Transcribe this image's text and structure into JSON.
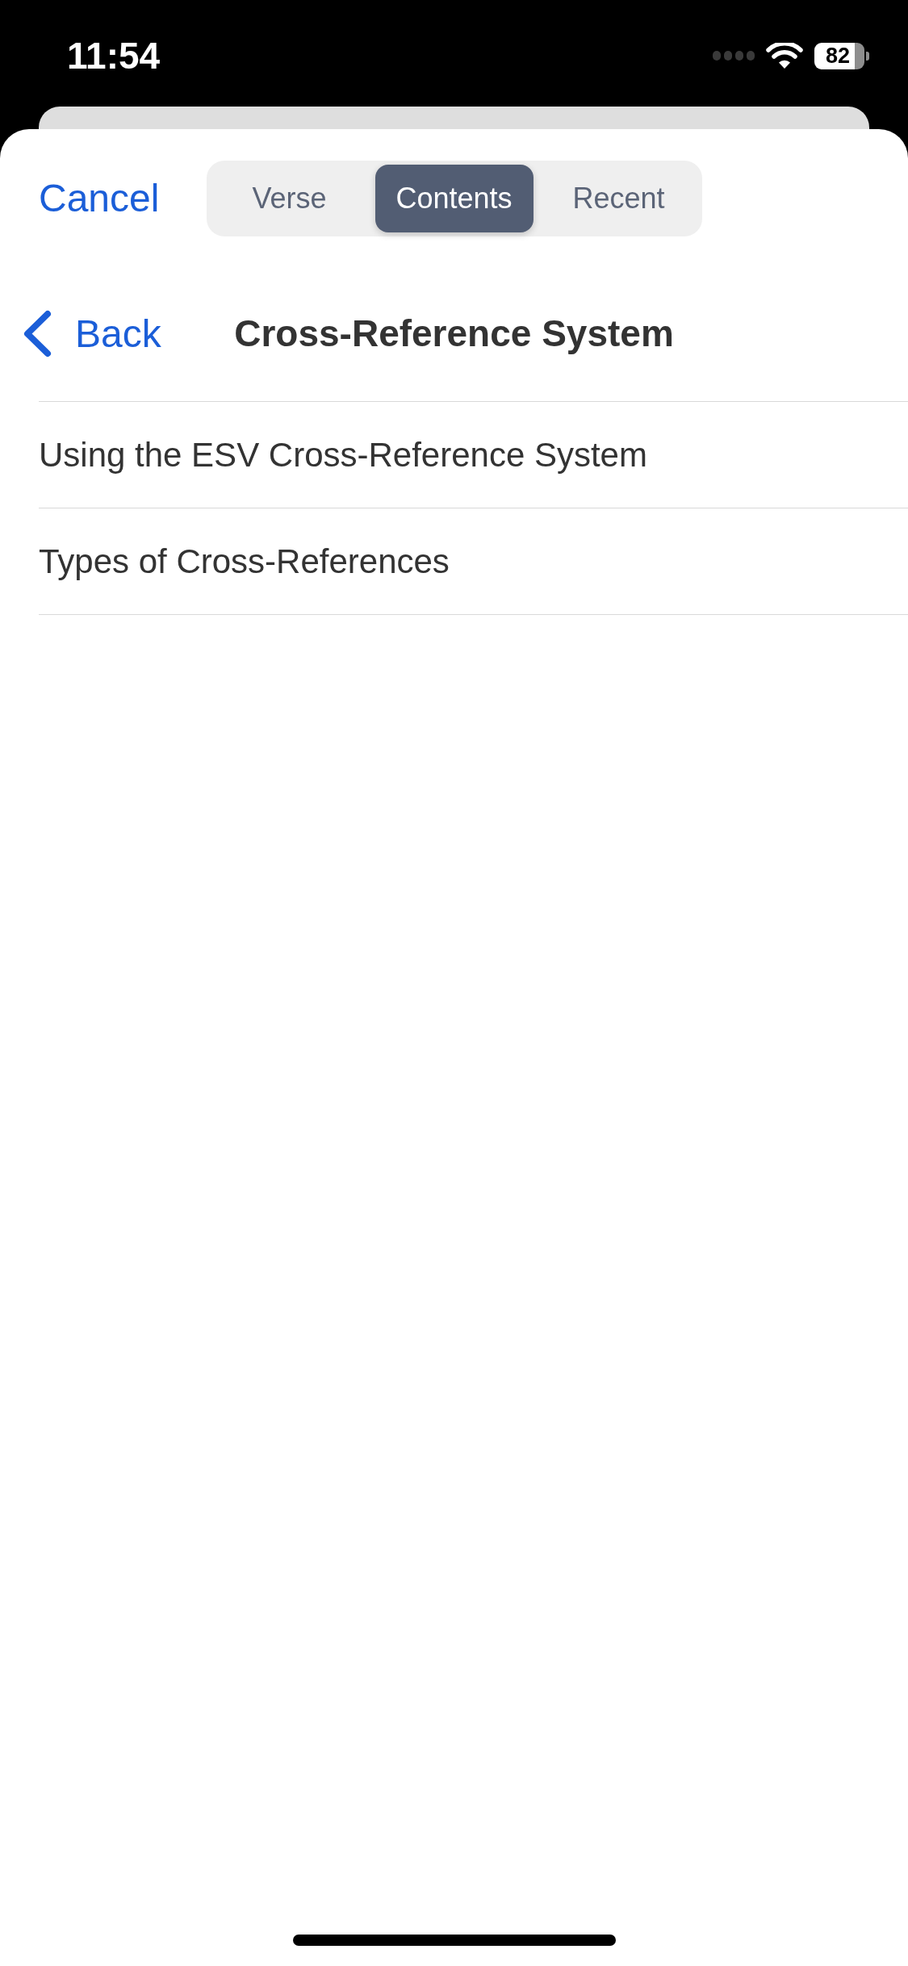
{
  "status_bar": {
    "time": "11:54",
    "battery": "82"
  },
  "header": {
    "cancel": "Cancel",
    "segments": [
      {
        "label": "Verse",
        "selected": false
      },
      {
        "label": "Contents",
        "selected": true
      },
      {
        "label": "Recent",
        "selected": false
      }
    ]
  },
  "nav": {
    "back": "Back",
    "title": "Cross-Reference System"
  },
  "items": [
    "Using the ESV Cross-Reference System",
    "Types of Cross-References"
  ]
}
